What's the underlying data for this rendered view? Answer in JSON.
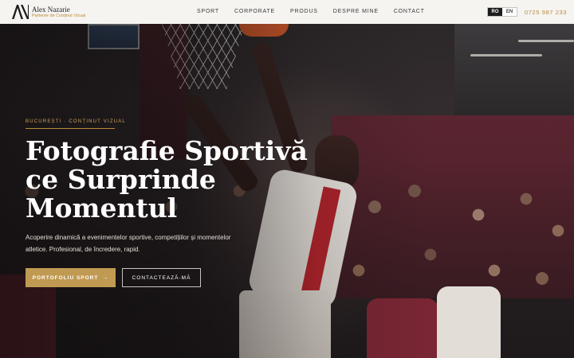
{
  "brand": {
    "name": "Alex Nazarie",
    "tagline": "Partener de Conținut Vizual",
    "logo_mark": "AN"
  },
  "nav": {
    "items": [
      {
        "label": "SPORT"
      },
      {
        "label": "CORPORATE"
      },
      {
        "label": "PRODUS"
      },
      {
        "label": "DESPRE MINE"
      },
      {
        "label": "CONTACT"
      }
    ]
  },
  "language": {
    "options": [
      "RO",
      "EN"
    ],
    "selected": "RO"
  },
  "phone": "0725 987 233",
  "hero": {
    "eyebrow": "BUCUREȘTI · CONȚINUT VIZUAL",
    "headline": [
      "Fotografie Sportivă",
      "ce Surprinde",
      "Momentul"
    ],
    "subcopy": "Acoperire dinamică a evenimentelor sportive, competițiilor și momentelor atletice. Profesional, de încredere, rapid.",
    "primary_button": "PORTOFOLIU SPORT",
    "primary_icon": "arrow-right-icon",
    "secondary_button": "CONTACTEAZĂ-MĂ"
  },
  "colors": {
    "accent": "#c09a52",
    "header_bg": "#f6f4f1",
    "dark": "#1c1c1c"
  }
}
